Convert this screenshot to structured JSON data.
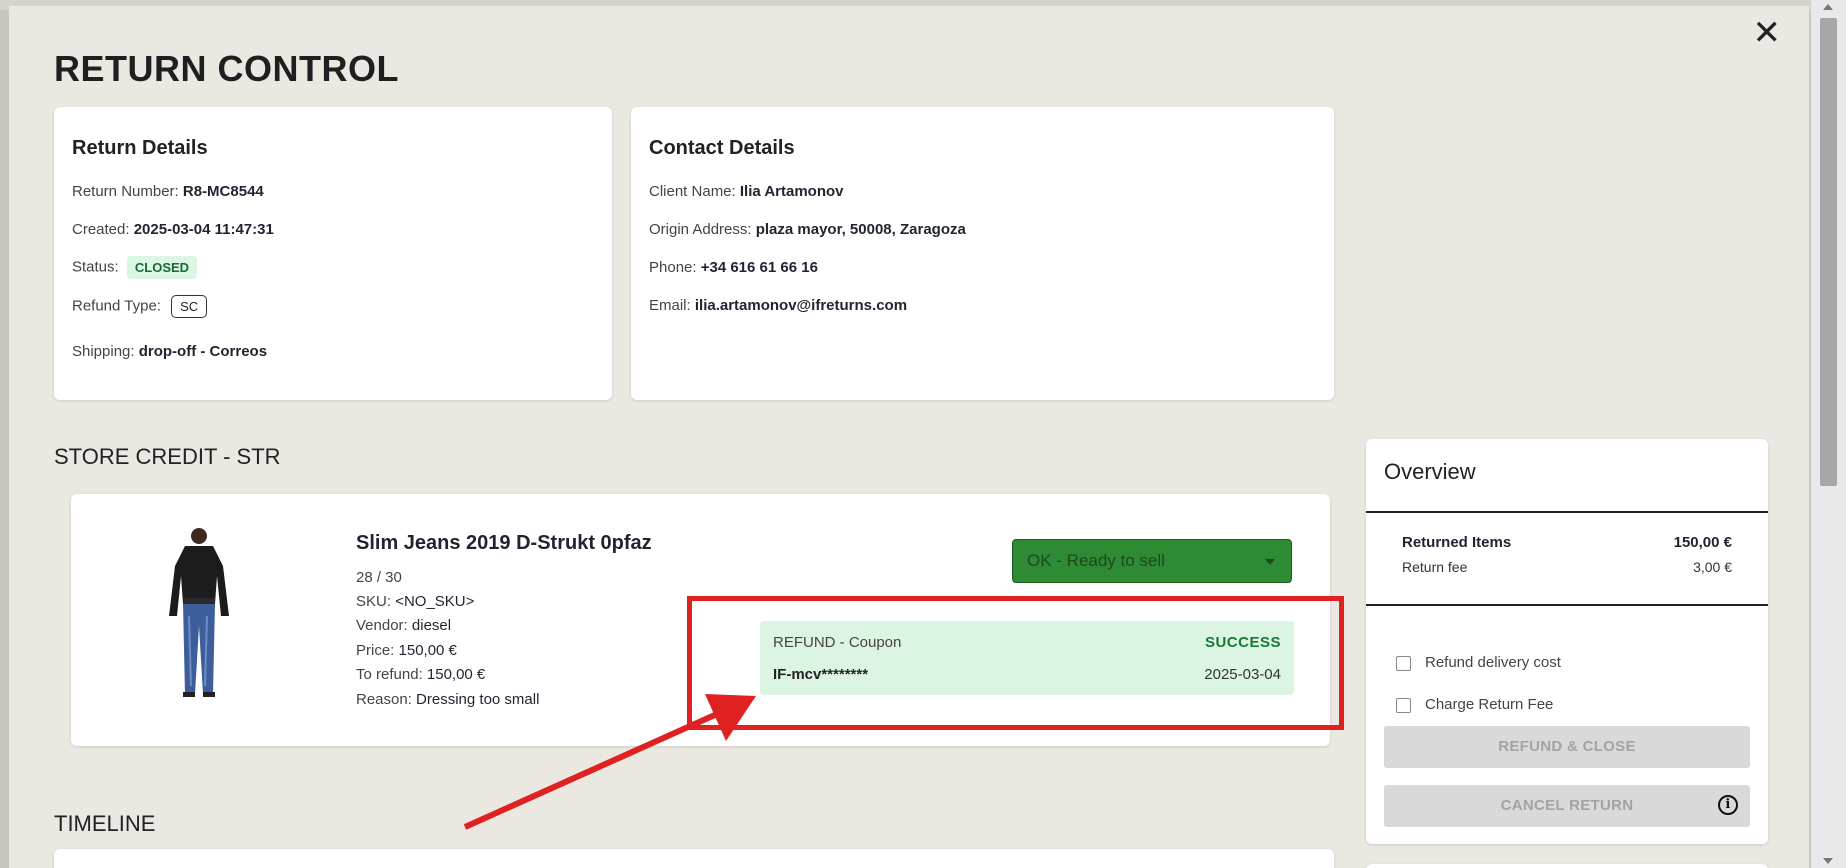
{
  "modal": {
    "title": "RETURN CONTROL"
  },
  "return_details": {
    "heading": "Return Details",
    "return_number_label": "Return Number:",
    "return_number": "R8-MC8544",
    "created_label": "Created:",
    "created": "2025-03-04 11:47:31",
    "status_label": "Status:",
    "status": "CLOSED",
    "refund_type_label": "Refund Type:",
    "refund_type": "SC",
    "shipping_label": "Shipping:",
    "shipping": "drop-off - Correos"
  },
  "contact_details": {
    "heading": "Contact Details",
    "client_name_label": "Client Name:",
    "client_name": "Ilia Artamonov",
    "origin_label": "Origin Address:",
    "origin": "plaza mayor, 50008, Zaragoza",
    "phone_label": "Phone:",
    "phone": "+34 616 61 66 16",
    "email_label": "Email:",
    "email": "ilia.artamonov@ifreturns.com"
  },
  "store_credit": {
    "title": "STORE CREDIT - STR",
    "product": {
      "name": "Slim Jeans 2019 D-Strukt 0pfaz",
      "size": "28 / 30",
      "sku_label": "SKU:",
      "sku": "<NO_SKU>",
      "vendor_label": "Vendor:",
      "vendor": "diesel",
      "price_label": "Price:",
      "price": "150,00 €",
      "to_refund_label": "To refund:",
      "to_refund": "150,00 €",
      "reason_label": "Reason:",
      "reason": "Dressing too small",
      "condition": "OK - Ready to sell"
    },
    "refund": {
      "type": "REFUND - Coupon",
      "status": "SUCCESS",
      "code": "IF-mcv********",
      "date": "2025-03-04"
    }
  },
  "timeline": {
    "title": "TIMELINE"
  },
  "overview": {
    "heading": "Overview",
    "returned_items_label": "Returned Items",
    "returned_items": "150,00 €",
    "return_fee_label": "Return fee",
    "return_fee": "3,00 €",
    "refund_delivery_label": "Refund delivery cost",
    "charge_fee_label": "Charge Return Fee",
    "refund_close_label": "REFUND & CLOSE",
    "cancel_label": "CANCEL RETURN"
  },
  "colors": {
    "accent_red": "#e02121",
    "success_green": "#137a36",
    "select_green": "#2f8a34"
  }
}
